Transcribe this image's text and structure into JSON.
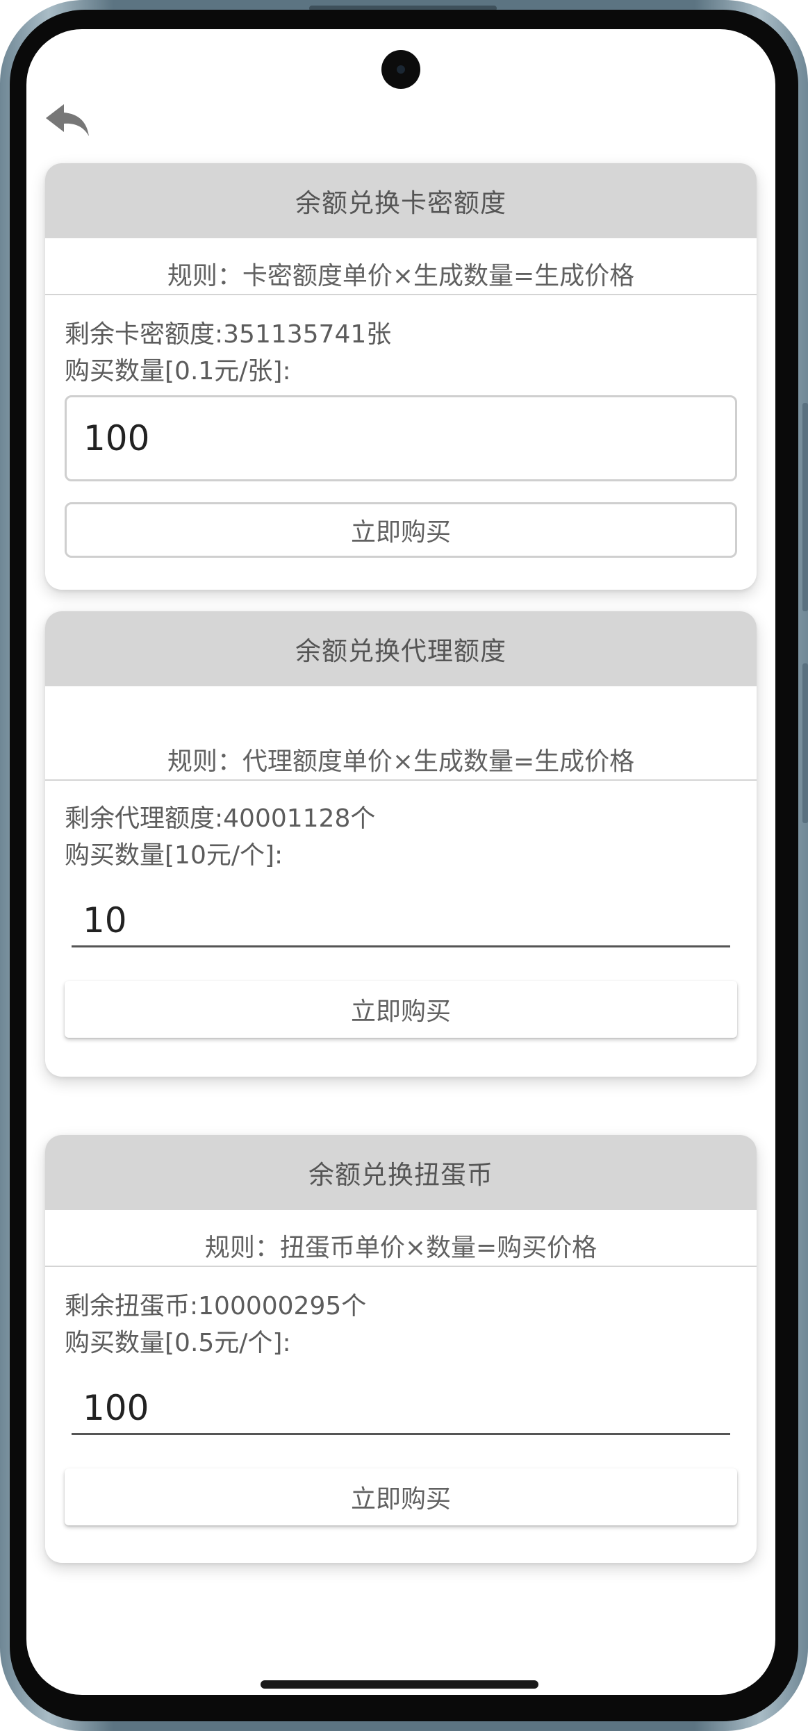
{
  "header": {
    "back_icon": "back-arrow-icon"
  },
  "cards": [
    {
      "title": "余额兑换卡密额度",
      "rule": "规则：卡密额度单价×生成数量=生成价格",
      "remaining": "剩余卡密额度:351135741张",
      "qty_label": "购买数量[0.1元/张]:",
      "qty_value": "100",
      "buy_label": "立即购买"
    },
    {
      "title": "余额兑换代理额度",
      "rule": "规则：代理额度单价×生成数量=生成价格",
      "remaining": "剩余代理额度:40001128个",
      "qty_label": "购买数量[10元/个]:",
      "qty_value": "10",
      "buy_label": "立即购买"
    },
    {
      "title": "余额兑换扭蛋币",
      "rule": "规则：扭蛋币单价×数量=购买价格",
      "remaining": "剩余扭蛋币:100000295个",
      "qty_label": "购买数量[0.5元/个]:",
      "qty_value": "100",
      "buy_label": "立即购买"
    }
  ]
}
